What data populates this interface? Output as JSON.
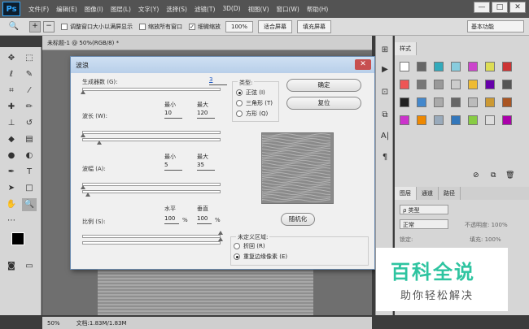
{
  "app": {
    "logo": "Ps"
  },
  "menu": [
    "文件(F)",
    "编辑(E)",
    "图像(I)",
    "图层(L)",
    "文字(Y)",
    "选择(S)",
    "滤镜(T)",
    "3D(D)",
    "视图(V)",
    "窗口(W)",
    "帮助(H)"
  ],
  "window_buttons": [
    "—",
    "□",
    "✕"
  ],
  "options": {
    "resize_windows": "调整窗口大小以满屏显示",
    "zoom_all": "缩放所有窗口",
    "scrubby_zoom": "细微缩放",
    "zoom_value": "100%",
    "fit_screen": "适合屏幕",
    "fill_screen": "填充屏幕",
    "workspace": "基本功能"
  },
  "document": {
    "tab": "未标题-1 @ 50%(RGB/8) *",
    "zoom": "50%",
    "doc_size": "文档:1.83M/1.83M"
  },
  "dialog": {
    "title": "波浪",
    "generators_label": "生成器数 (G):",
    "generators_value": "3",
    "min_label": "最小",
    "max_label": "最大",
    "wavelength_label": "波长 (W):",
    "wavelength_min": "10",
    "wavelength_max": "120",
    "amplitude_label": "波幅 (A):",
    "amplitude_min": "5",
    "amplitude_max": "35",
    "scale_label": "比例 (S):",
    "horiz_label": "水平",
    "vert_label": "垂直",
    "scale_h": "100",
    "scale_v": "100",
    "pct": "%",
    "type_label": "类型:",
    "type_sine": "正弦 (I)",
    "type_triangle": "三角形 (T)",
    "type_square": "方形 (Q)",
    "ok": "确定",
    "reset": "复位",
    "randomize": "随机化",
    "undefined_label": "未定义区域:",
    "wrap": "折回 (R)",
    "repeat_edge": "重复边缘像素 (E)"
  },
  "panels": {
    "styles_tab": "样式",
    "layers_tabs": [
      "图层",
      "通道",
      "路径"
    ],
    "kind": "ρ 类型",
    "blend": "正常",
    "opacity": "不透明度: 100%",
    "lock": "锁定:",
    "fill": "填充: 100%"
  },
  "watermark": {
    "main": "百科全说",
    "sub": "助你轻松解决"
  },
  "colors": {
    "accent_green": "#2ec4a0",
    "ps_blue": "#31a8ff"
  }
}
